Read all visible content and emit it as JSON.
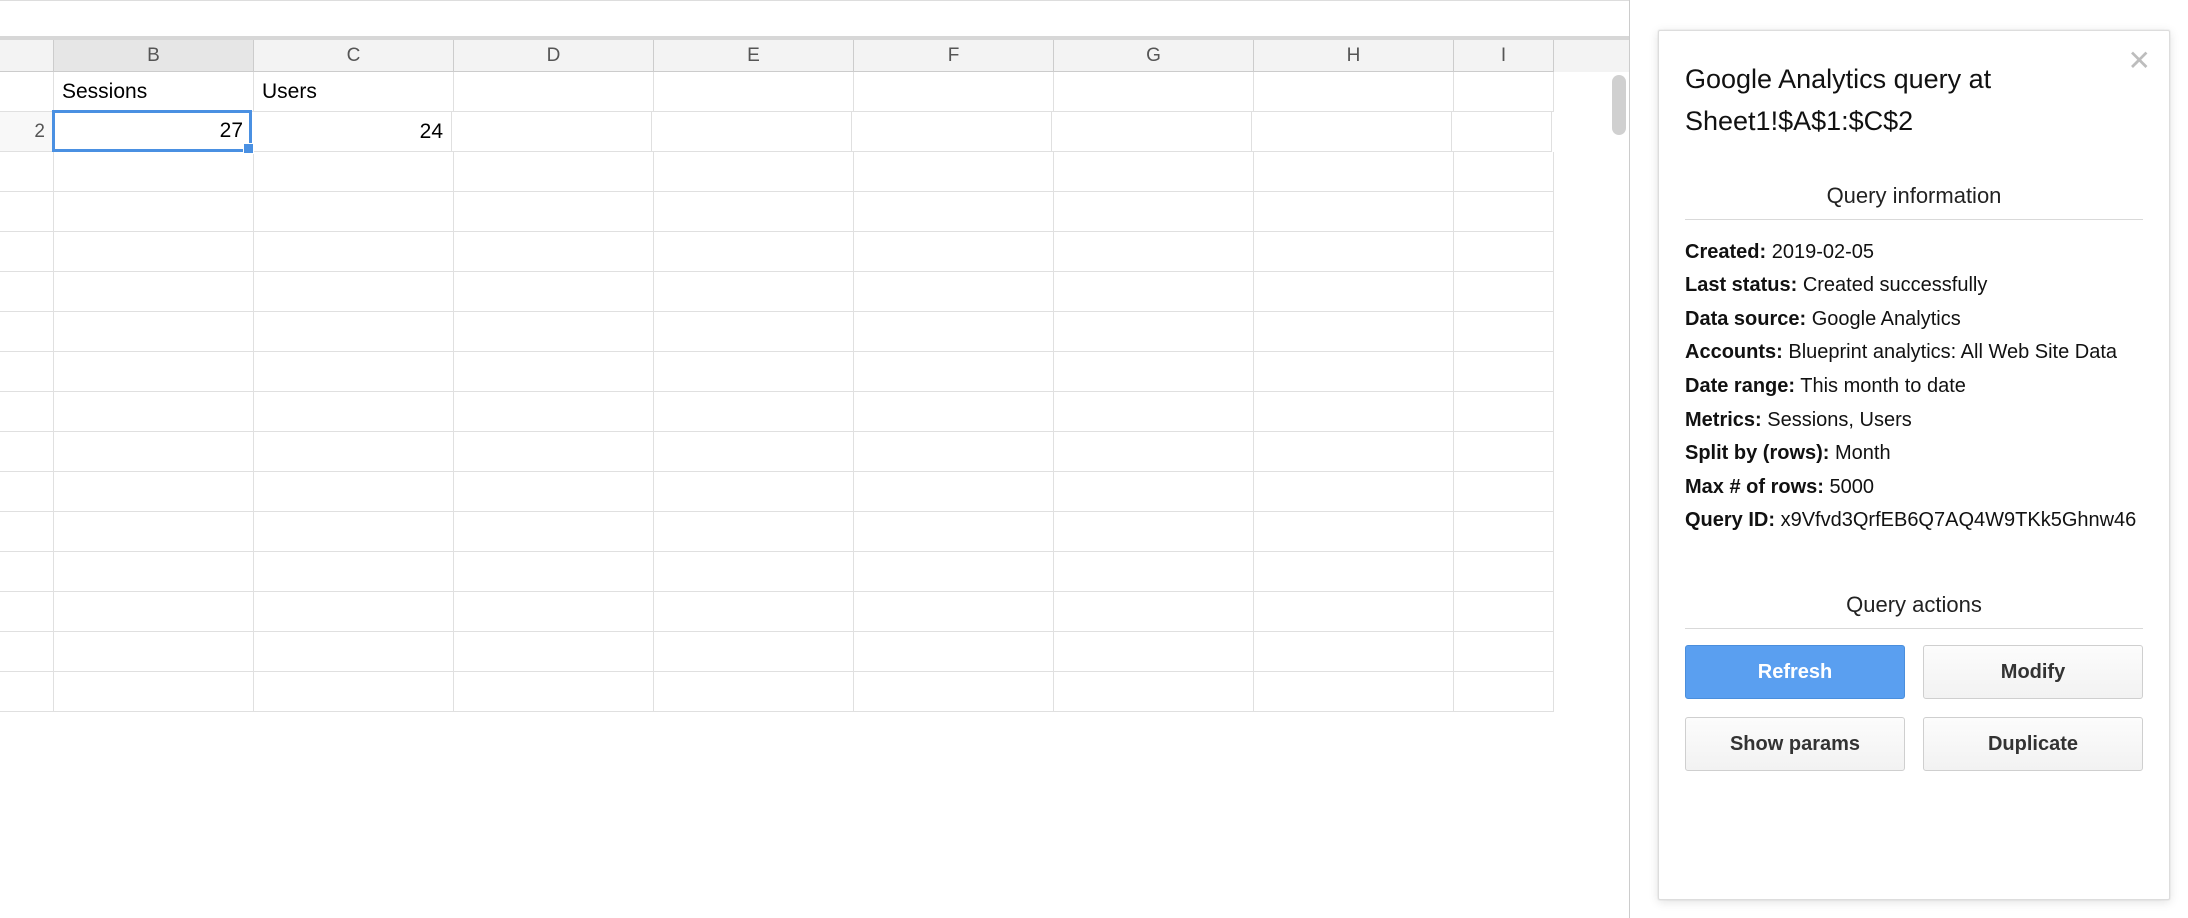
{
  "sheet": {
    "columns": [
      "B",
      "C",
      "D",
      "E",
      "F",
      "G",
      "H",
      "I"
    ],
    "selected_column": "B",
    "row1": {
      "B": "Sessions",
      "C": "Users"
    },
    "row2": {
      "label": "2",
      "B": "27",
      "C": "24"
    },
    "selected_cell": "B2"
  },
  "panel": {
    "title": "Google Analytics query at Sheet1!$A$1:$C$2",
    "info_heading": "Query information",
    "info": {
      "created_label": "Created:",
      "created": "2019-02-05",
      "status_label": "Last status:",
      "status": "Created successfully",
      "source_label": "Data source:",
      "source": "Google Analytics",
      "accounts_label": "Accounts:",
      "accounts": "Blueprint analytics: All Web Site Data",
      "daterange_label": "Date range:",
      "daterange": "This month to date",
      "metrics_label": "Metrics:",
      "metrics": "Sessions, Users",
      "splitby_label": "Split by (rows):",
      "splitby": "Month",
      "maxrows_label": "Max # of rows:",
      "maxrows": "5000",
      "queryid_label": "Query ID:",
      "queryid": "x9Vfvd3QrfEB6Q7AQ4W9TKk5Ghnw46"
    },
    "actions_heading": "Query actions",
    "buttons": {
      "refresh": "Refresh",
      "modify": "Modify",
      "show_params": "Show params",
      "duplicate": "Duplicate"
    }
  }
}
